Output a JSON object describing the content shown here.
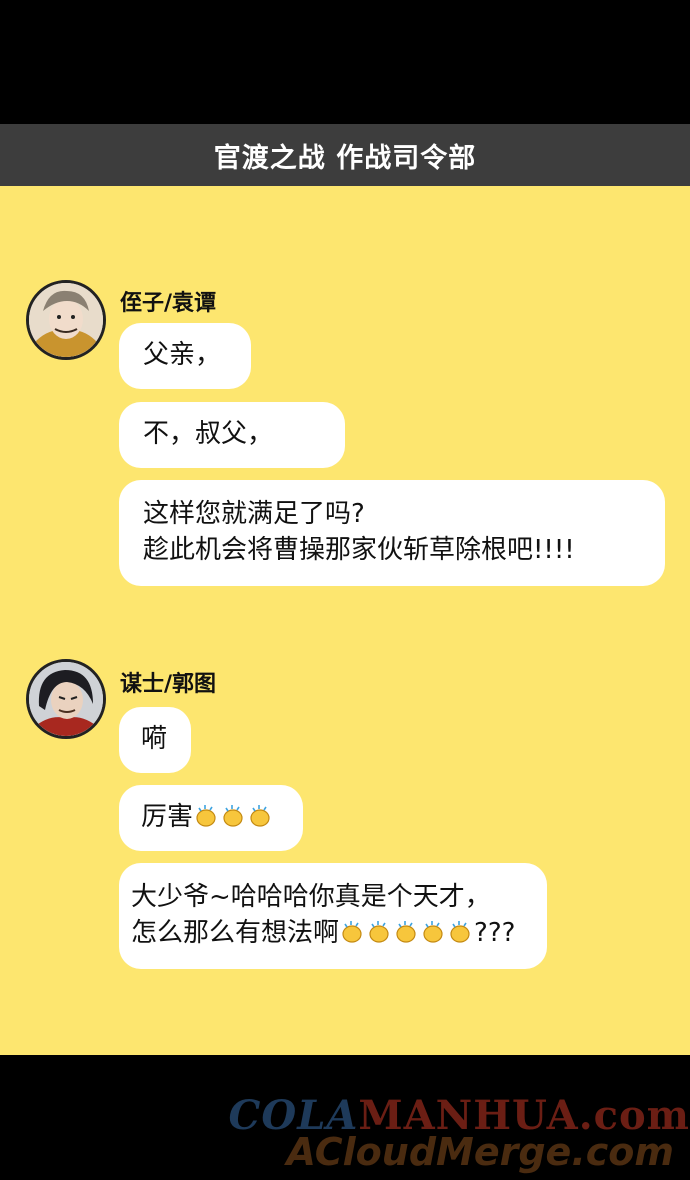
{
  "header": {
    "title": "官渡之战 作战司令部"
  },
  "chat": {
    "group1": {
      "name": "侄子/袁谭",
      "messages": [
        [
          "父亲，"
        ],
        [
          "不，叔父，"
        ],
        [
          "这样您就满足了吗?",
          "趁此机会将曹操那家伙斩草除根吧!!!!"
        ]
      ]
    },
    "group2": {
      "name": "谋士/郭图",
      "messages": [
        [
          "嗬"
        ],
        [
          "厉害"
        ],
        [
          "大少爷~哈哈哈你真是个天才，",
          "怎么那么有想法啊",
          "???"
        ]
      ],
      "emoji": "clapping-hands"
    }
  },
  "watermark": {
    "line1_a": "COLA",
    "line1_b": "MANHUA.com",
    "line2": "ACloudMerge.com"
  }
}
